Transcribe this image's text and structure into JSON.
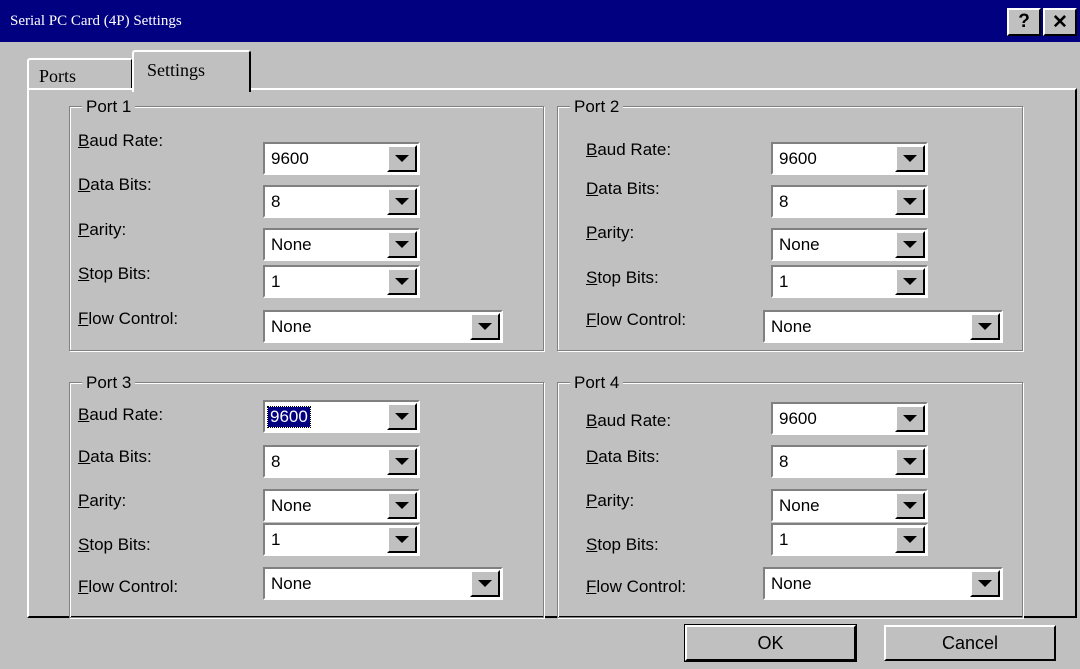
{
  "window": {
    "title": "Serial PC Card (4P) Settings",
    "help_label": "?",
    "close_label": "✕"
  },
  "tabs": [
    {
      "label": "Ports",
      "selected": false
    },
    {
      "label": "Settings",
      "selected": true
    }
  ],
  "labels": {
    "baud_rate": {
      "mnemonic": "B",
      "rest": "aud Rate:"
    },
    "data_bits": {
      "mnemonic": "D",
      "rest": "ata Bits:"
    },
    "parity": {
      "mnemonic": "P",
      "rest": "arity:"
    },
    "stop_bits": {
      "mnemonic": "S",
      "rest": "top Bits:"
    },
    "flow_control": {
      "mnemonic": "F",
      "rest": "low Control:"
    }
  },
  "ports": [
    {
      "title": "Port 1",
      "baud_rate": "9600",
      "data_bits": "8",
      "parity": "None",
      "stop_bits": "1",
      "flow_control": "None"
    },
    {
      "title": "Port 2",
      "baud_rate": "9600",
      "data_bits": "8",
      "parity": "None",
      "stop_bits": "1",
      "flow_control": "None"
    },
    {
      "title": "Port 3",
      "baud_rate": "9600",
      "data_bits": "8",
      "parity": "None",
      "stop_bits": "1",
      "flow_control": "None"
    },
    {
      "title": "Port 4",
      "baud_rate": "9600",
      "data_bits": "8",
      "parity": "None",
      "stop_bits": "1",
      "flow_control": "None"
    }
  ],
  "focused": {
    "port": "Port 3",
    "field": "baud_rate"
  },
  "buttons": {
    "ok": "OK",
    "cancel": "Cancel"
  },
  "colors": {
    "titlebar": "#000080",
    "face": "#c0c0c0",
    "selection": "#000080"
  }
}
